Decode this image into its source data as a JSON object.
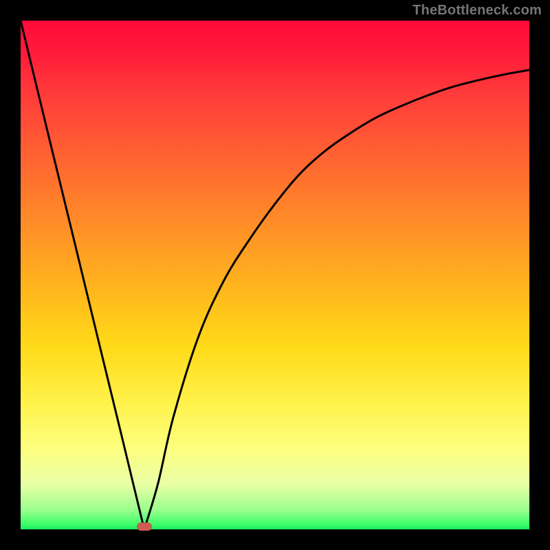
{
  "watermark": "TheBottleneck.com",
  "chart_data": {
    "type": "line",
    "title": "",
    "xlabel": "",
    "ylabel": "",
    "xlim": [
      0,
      100
    ],
    "ylim": [
      0,
      100
    ],
    "grid": false,
    "legend": false,
    "note": "Single black curve resembling a bottleneck V-dip on a red→green vertical gradient. Values estimated from pixel positions; 0 is bottom, 100 is top.",
    "series": [
      {
        "name": "bottleneck-curve",
        "x": [
          0,
          5,
          10,
          15,
          20,
          22,
          24.3,
          27,
          30,
          35,
          40,
          45,
          50,
          55,
          60,
          65,
          70,
          75,
          80,
          85,
          90,
          95,
          100
        ],
        "values": [
          100,
          79.4,
          58.9,
          38.3,
          17.8,
          9.5,
          0,
          9,
          22,
          38,
          49,
          57,
          64,
          70,
          74.5,
          78,
          81,
          83.3,
          85.3,
          87,
          88.3,
          89.4,
          90.3
        ]
      }
    ],
    "marker": {
      "name": "min-point-pill",
      "x": 24.3,
      "y": 0,
      "color": "#cc5b52"
    },
    "gradient_stops": [
      {
        "pos": 0,
        "color": "#ff0a3a"
      },
      {
        "pos": 25,
        "color": "#ff6a30"
      },
      {
        "pos": 50,
        "color": "#ffc21e"
      },
      {
        "pos": 75,
        "color": "#fff24a"
      },
      {
        "pos": 92,
        "color": "#eaffa5"
      },
      {
        "pos": 100,
        "color": "#18e861"
      }
    ]
  }
}
